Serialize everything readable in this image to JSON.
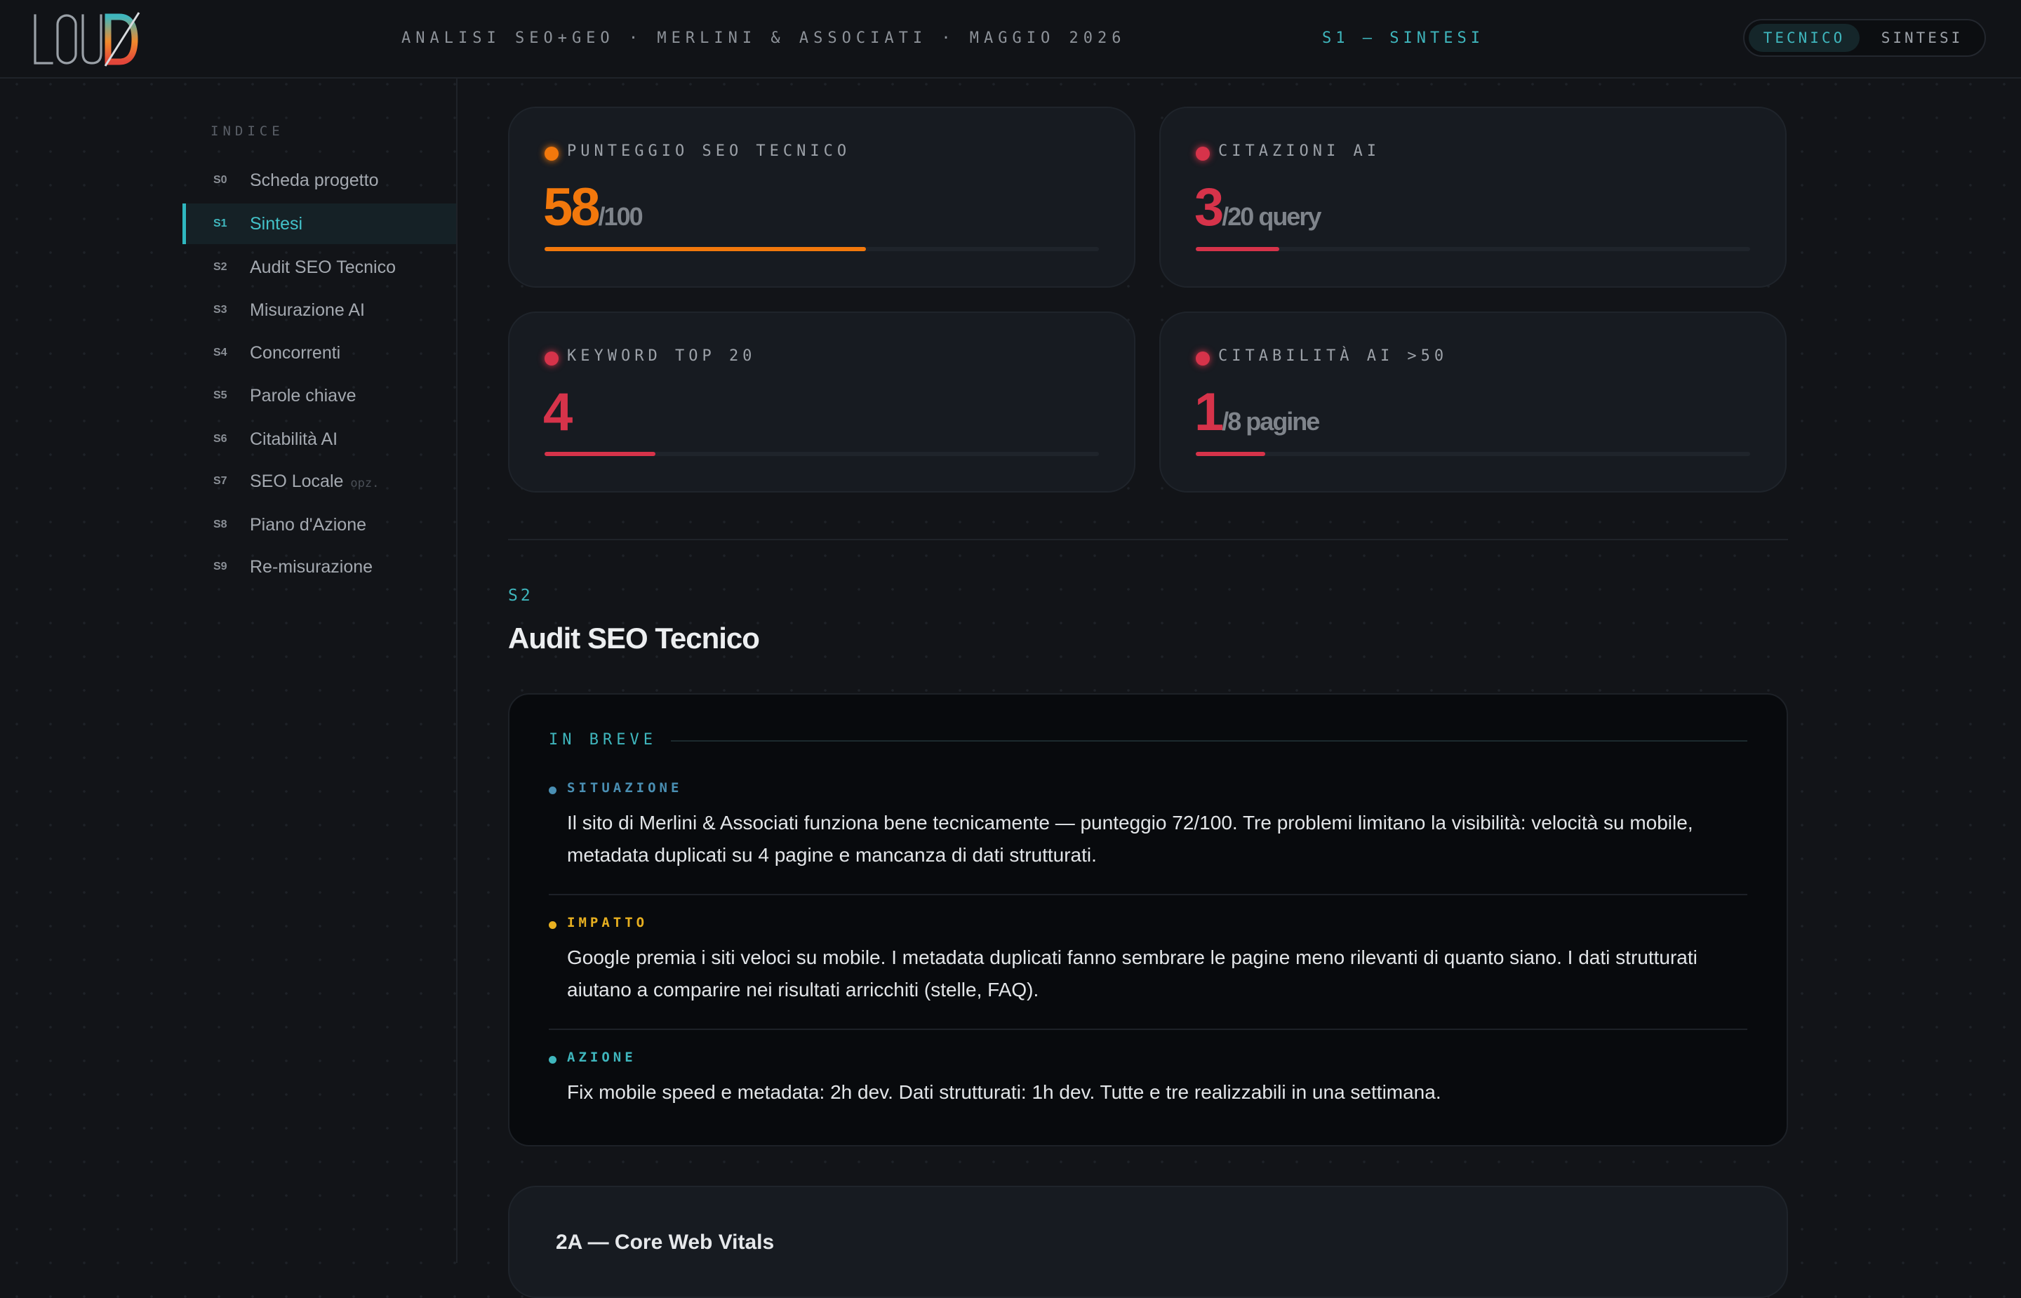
{
  "header": {
    "project_title": "ANALISI SEO+GEO · MERLINI & ASSOCIATI · MAGGIO 2026",
    "section_indicator": "S1 — SINTESI",
    "toggle": {
      "active": "TECNICO",
      "inactive": "SINTESI"
    }
  },
  "sidebar": {
    "title": "INDICE",
    "items": [
      {
        "code": "S0",
        "label": "Scheda progetto"
      },
      {
        "code": "S1",
        "label": "Sintesi"
      },
      {
        "code": "S2",
        "label": "Audit SEO Tecnico"
      },
      {
        "code": "S3",
        "label": "Misurazione AI"
      },
      {
        "code": "S4",
        "label": "Concorrenti"
      },
      {
        "code": "S5",
        "label": "Parole chiave"
      },
      {
        "code": "S6",
        "label": "Citabilità AI"
      },
      {
        "code": "S7",
        "label": "SEO Locale",
        "badge": "opz."
      },
      {
        "code": "S8",
        "label": "Piano d'Azione"
      },
      {
        "code": "S9",
        "label": "Re-misurazione"
      }
    ]
  },
  "cards": [
    {
      "label": "PUNTEGGIO SEO TECNICO",
      "value": "58",
      "unit": "/100",
      "progress": 0.58,
      "color": "#f2780c"
    },
    {
      "label": "CITAZIONI AI",
      "value": "3",
      "unit": "/20 query",
      "progress": 0.15,
      "color": "#d6334a"
    },
    {
      "label": "KEYWORD TOP 20",
      "value": "4",
      "unit": "",
      "progress": 0.2,
      "color": "#d6334a"
    },
    {
      "label": "CITABILITÀ AI >50",
      "value": "1",
      "unit": "/8 pagine",
      "progress": 0.125,
      "color": "#d6334a"
    }
  ],
  "section": {
    "code": "S2",
    "title": "Audit SEO Tecnico"
  },
  "brief": {
    "heading": "IN BREVE",
    "rows": [
      {
        "label": "SITUAZIONE",
        "color": "#4a8fb3",
        "text": "Il sito di Merlini & Associati funziona bene tecnicamente — punteggio 72/100. Tre problemi limitano la visibilità: velocità su mobile, metadata duplicati su 4 pagine e mancanza di dati strutturati."
      },
      {
        "label": "IMPATTO",
        "color": "#e8b020",
        "text": "Google premia i siti veloci su mobile. I metadata duplicati fanno sembrare le pagine meno rilevanti di quanto siano. I dati strutturati aiutano a comparire nei risultati arricchiti (stelle, FAQ)."
      },
      {
        "label": "AZIONE",
        "color": "#3fb6bd",
        "text": "Fix mobile speed e metadata: 2h dev. Dati strutturati: 1h dev. Tutte e tre realizzabili in una settimana."
      }
    ]
  },
  "subsection": {
    "title": "2A — Core Web Vitals"
  }
}
